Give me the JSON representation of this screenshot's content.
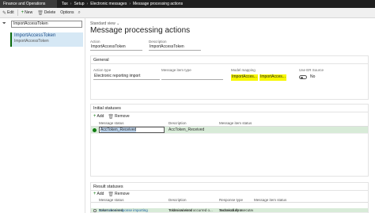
{
  "topbar": {
    "app_name": "Finance and Operations",
    "breadcrumbs": [
      "Tax",
      "Setup",
      "Electronic messages",
      "Message processing actions"
    ]
  },
  "actionbar": {
    "save": "Edit",
    "new": "New",
    "delete": "Delete",
    "options": "Options"
  },
  "leftpane": {
    "filter_value": "ImportAccessToken",
    "selected_item": {
      "title": "ImportAccessToken",
      "subtitle": "ImportAccessToken"
    }
  },
  "main": {
    "standard_view": "Standard view",
    "title": "Message processing actions",
    "action_label": "Action",
    "action_value": "ImportAccessToken",
    "description_label": "Description",
    "description_value": "ImportAccessToken"
  },
  "general": {
    "header": "General",
    "action_type_label": "Action type",
    "action_type_value": "Electronic reporting import",
    "message_item_type_label": "Message item type",
    "message_item_type_value": "",
    "model_mapping_label": "Model mapping",
    "model_mapping_value1": "ImportAcces...",
    "model_mapping_value2": "ImportAcces...",
    "use_er_source_label": "Use ER Source",
    "use_er_source_value": "No"
  },
  "initial_statuses": {
    "header": "Initial statuses",
    "add": "Add",
    "remove": "Remove",
    "columns": [
      "Message status",
      "Description",
      "Message item status"
    ],
    "rows": [
      {
        "status": "AccToken_Received",
        "description": "AccToken_Received",
        "item_status": ""
      }
    ]
  },
  "result_statuses": {
    "header": "Result statuses",
    "add": "Add",
    "remove": "Remove",
    "columns": [
      "Message status",
      "Description",
      "Response type",
      "Message item status"
    ],
    "rows": [
      {
        "status": "Error token response importing",
        "description": "Technical error occurred o...",
        "response_type": "Technical error",
        "item_status": ""
      },
      {
        "status": "Token received",
        "description": "Token received",
        "response_type": "Successfully executed",
        "item_status": ""
      }
    ]
  },
  "colors": {
    "accent": "#107c10",
    "highlight": "#f7f700",
    "topbar": "#1f1f1f"
  }
}
